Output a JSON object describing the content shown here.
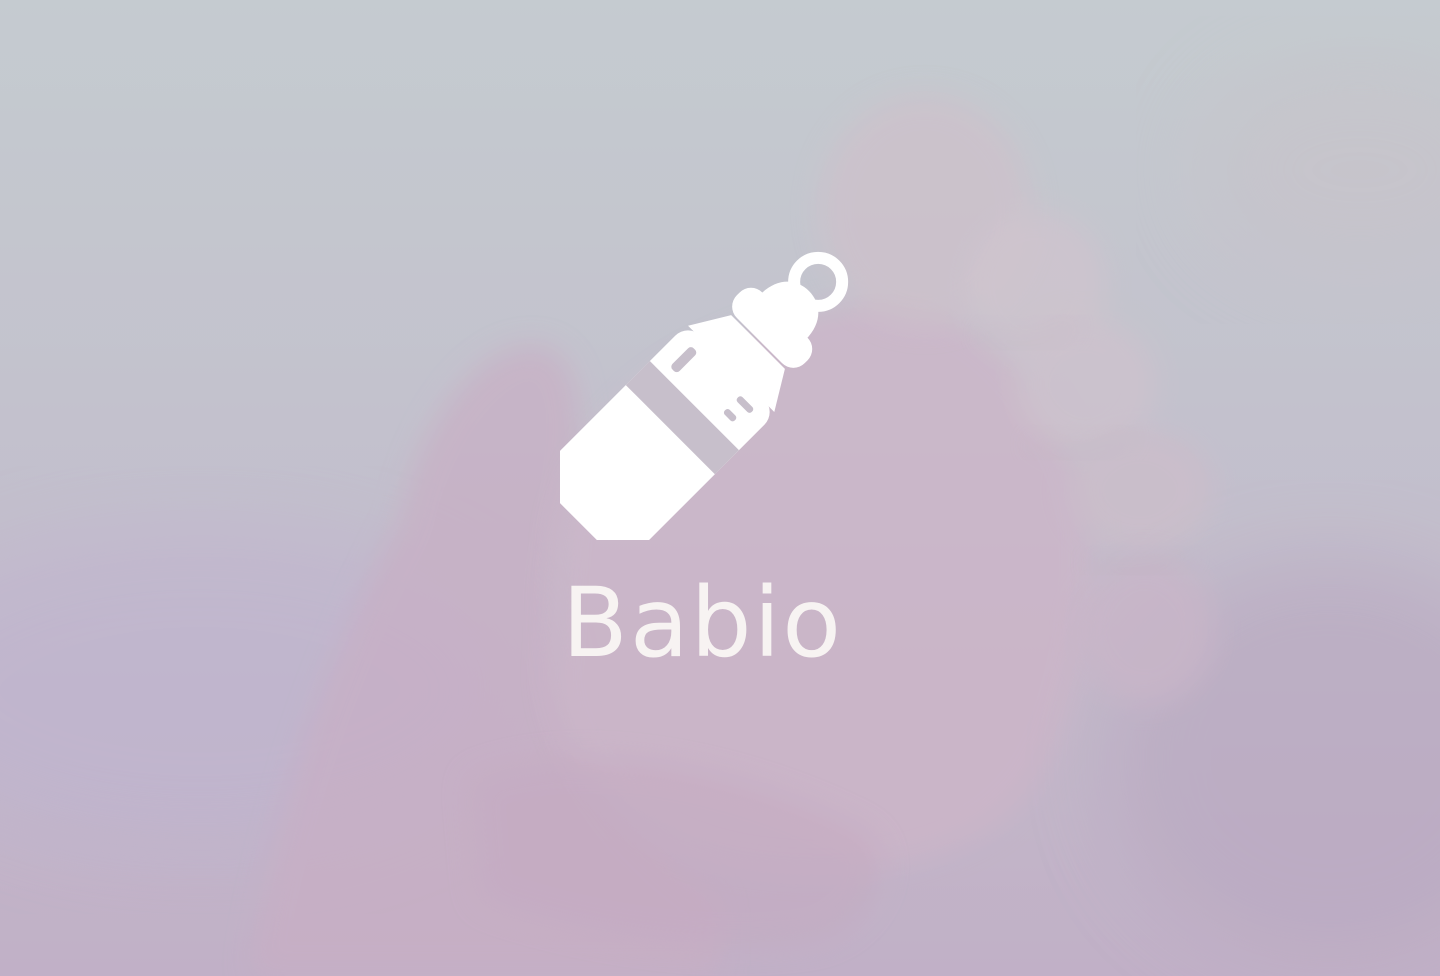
{
  "splash": {
    "app_name": "Babio",
    "logo_icon": "baby-bottle-icon",
    "background": "blurred-baby-foot-in-hand-photo"
  },
  "colors": {
    "overlay_top": "#c3cbcf",
    "overlay_bottom": "#b9a6c0",
    "foreground": "#f7f3f2"
  }
}
